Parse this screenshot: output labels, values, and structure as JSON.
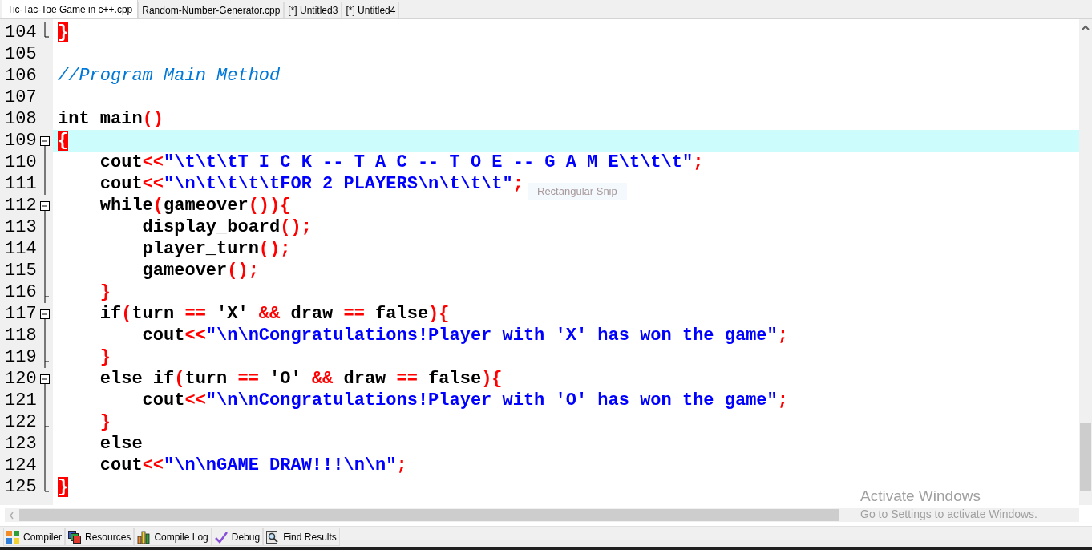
{
  "tabs": [
    {
      "label": "Tic-Tac-Toe Game in c++.cpp",
      "selected": true
    },
    {
      "label": "Random-Number-Generator.cpp",
      "selected": false
    },
    {
      "label": "[*] Untitled3",
      "selected": false
    },
    {
      "label": "[*] Untitled4",
      "selected": false
    }
  ],
  "editor": {
    "lines": [
      {
        "number": "104",
        "kind": "fold_end",
        "current": false,
        "tokens": [
          {
            "kind": "match",
            "text": "}"
          }
        ]
      },
      {
        "number": "105",
        "kind": "plain",
        "current": false
      },
      {
        "number": "106",
        "kind": "plain",
        "current": false,
        "tokens": [
          {
            "kind": "comment",
            "text": "//Program Main Method"
          }
        ]
      },
      {
        "number": "107",
        "kind": "plain",
        "current": false
      },
      {
        "number": "108",
        "kind": "plain",
        "current": false,
        "tokens": [
          {
            "kind": "keyword",
            "text": "int"
          },
          {
            "kind": "plain",
            "text": " main"
          },
          {
            "kind": "symbol",
            "text": "()"
          }
        ]
      },
      {
        "number": "109",
        "kind": "fold_start",
        "current": true,
        "tokens": [
          {
            "kind": "match",
            "text": "{"
          }
        ]
      },
      {
        "number": "110",
        "kind": "fold_body",
        "current": false,
        "tokens": [
          {
            "kind": "plain",
            "text": "    cout"
          },
          {
            "kind": "symbol",
            "text": "<<"
          },
          {
            "kind": "string",
            "text": "\"\\t\\t\\tT I C K -- T A C -- T O E -- G A M E\\t\\t\\t\""
          },
          {
            "kind": "symbol",
            "text": ";"
          }
        ]
      },
      {
        "number": "111",
        "kind": "fold_body",
        "current": false,
        "tokens": [
          {
            "kind": "plain",
            "text": "    cout"
          },
          {
            "kind": "symbol",
            "text": "<<"
          },
          {
            "kind": "string",
            "text": "\"\\n\\t\\t\\t\\tFOR 2 PLAYERS\\n\\t\\t\\t\""
          },
          {
            "kind": "symbol",
            "text": ";"
          }
        ]
      },
      {
        "number": "112",
        "kind": "fold_start",
        "current": false,
        "tokens": [
          {
            "kind": "keyword",
            "text": "    while"
          },
          {
            "kind": "symbol",
            "text": "("
          },
          {
            "kind": "plain",
            "text": "gameover"
          },
          {
            "kind": "symbol",
            "text": "()){"
          }
        ]
      },
      {
        "number": "113",
        "kind": "fold_body",
        "current": false,
        "tokens": [
          {
            "kind": "plain",
            "text": "        display_board"
          },
          {
            "kind": "symbol",
            "text": "();"
          }
        ]
      },
      {
        "number": "114",
        "kind": "fold_body",
        "current": false,
        "tokens": [
          {
            "kind": "plain",
            "text": "        player_turn"
          },
          {
            "kind": "symbol",
            "text": "();"
          }
        ]
      },
      {
        "number": "115",
        "kind": "fold_body",
        "current": false,
        "tokens": [
          {
            "kind": "plain",
            "text": "        gameover"
          },
          {
            "kind": "symbol",
            "text": "();"
          }
        ]
      },
      {
        "number": "116",
        "kind": "fold_branch",
        "current": false,
        "tokens": [
          {
            "kind": "symbol",
            "text": "    }"
          }
        ]
      },
      {
        "number": "117",
        "kind": "fold_start",
        "current": false,
        "tokens": [
          {
            "kind": "keyword",
            "text": "    if"
          },
          {
            "kind": "symbol",
            "text": "("
          },
          {
            "kind": "plain",
            "text": "turn "
          },
          {
            "kind": "symbol",
            "text": "=="
          },
          {
            "kind": "plain",
            "text": " 'X' "
          },
          {
            "kind": "symbol",
            "text": "&&"
          },
          {
            "kind": "plain",
            "text": " draw "
          },
          {
            "kind": "symbol",
            "text": "=="
          },
          {
            "kind": "keyword",
            "text": " false"
          },
          {
            "kind": "symbol",
            "text": "){"
          }
        ]
      },
      {
        "number": "118",
        "kind": "fold_body",
        "current": false,
        "tokens": [
          {
            "kind": "plain",
            "text": "        cout"
          },
          {
            "kind": "symbol",
            "text": "<<"
          },
          {
            "kind": "string",
            "text": "\"\\n\\nCongratulations!Player with 'X' has won the game\""
          },
          {
            "kind": "symbol",
            "text": ";"
          }
        ]
      },
      {
        "number": "119",
        "kind": "fold_branch",
        "current": false,
        "tokens": [
          {
            "kind": "symbol",
            "text": "    }"
          }
        ]
      },
      {
        "number": "120",
        "kind": "fold_start",
        "current": false,
        "tokens": [
          {
            "kind": "keyword",
            "text": "    else if"
          },
          {
            "kind": "symbol",
            "text": "("
          },
          {
            "kind": "plain",
            "text": "turn "
          },
          {
            "kind": "symbol",
            "text": "=="
          },
          {
            "kind": "plain",
            "text": " 'O' "
          },
          {
            "kind": "symbol",
            "text": "&&"
          },
          {
            "kind": "plain",
            "text": " draw "
          },
          {
            "kind": "symbol",
            "text": "=="
          },
          {
            "kind": "keyword",
            "text": " false"
          },
          {
            "kind": "symbol",
            "text": "){"
          }
        ]
      },
      {
        "number": "121",
        "kind": "fold_body",
        "current": false,
        "tokens": [
          {
            "kind": "plain",
            "text": "        cout"
          },
          {
            "kind": "symbol",
            "text": "<<"
          },
          {
            "kind": "string",
            "text": "\"\\n\\nCongratulations!Player with 'O' has won the game\""
          },
          {
            "kind": "symbol",
            "text": ";"
          }
        ]
      },
      {
        "number": "122",
        "kind": "fold_branch",
        "current": false,
        "tokens": [
          {
            "kind": "symbol",
            "text": "    }"
          }
        ]
      },
      {
        "number": "123",
        "kind": "fold_body",
        "current": false,
        "tokens": [
          {
            "kind": "keyword",
            "text": "    else"
          }
        ]
      },
      {
        "number": "124",
        "kind": "fold_body",
        "current": false,
        "tokens": [
          {
            "kind": "plain",
            "text": "    cout"
          },
          {
            "kind": "symbol",
            "text": "<<"
          },
          {
            "kind": "string",
            "text": "\"\\n\\nGAME DRAW!!!\\n\\n\""
          },
          {
            "kind": "symbol",
            "text": ";"
          }
        ]
      },
      {
        "number": "125",
        "kind": "fold_end",
        "current": false,
        "tokens": [
          {
            "kind": "match",
            "text": "}"
          }
        ]
      }
    ]
  },
  "snip_tooltip": "Rectangular Snip",
  "activation_notice": {
    "title": "Activate Windows",
    "text": "Go to Settings to activate Windows."
  },
  "bottom_tabs": [
    {
      "label": "Compiler"
    },
    {
      "label": "Resources"
    },
    {
      "label": "Compile Log"
    },
    {
      "label": "Debug"
    },
    {
      "label": "Find Results"
    }
  ]
}
